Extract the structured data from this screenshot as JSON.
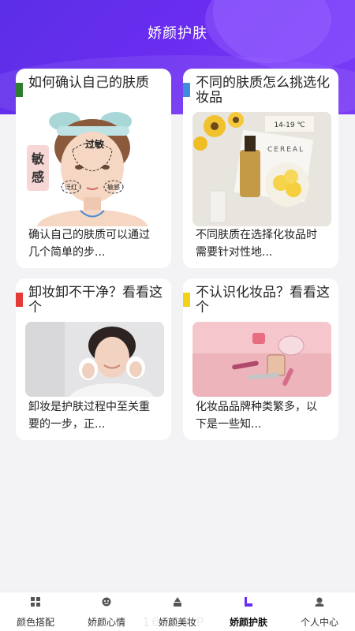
{
  "header": {
    "title": "娇颜护肤"
  },
  "cards": [
    {
      "title": "如何确认自己的肤质",
      "accent": "#2e7d32",
      "description": "确认自己的肤质可以通过几个简单的步...",
      "image_labels": {
        "big": "敏感",
        "top": "过敏",
        "left": "泛红",
        "right": "敏感"
      }
    },
    {
      "title": "不同的肤质怎么挑选化妆品",
      "accent": "#3f8be0",
      "description": "不同肤质在选择化妆品时需要针对性地...",
      "image_labels": {
        "tag": "14-19 ℃",
        "brand": "CEREAL"
      }
    },
    {
      "title": "卸妆卸不干净？看看这个",
      "accent": "#e53935",
      "description": "卸妆是护肤过程中至关重要的一步，正..."
    },
    {
      "title": "不认识化妆品？看看这个",
      "accent": "#f2d21b",
      "description": "化妆品品牌种类繁多，以下是一些知..."
    }
  ],
  "nav": [
    {
      "label": "颜色搭配",
      "icon": "grid-icon"
    },
    {
      "label": "娇颜心情",
      "icon": "smile-icon"
    },
    {
      "label": "娇颜美妆",
      "icon": "makeup-icon"
    },
    {
      "label": "娇颜护肤",
      "icon": "skincare-icon",
      "active": true
    },
    {
      "label": "个人中心",
      "icon": "user-icon"
    }
  ],
  "watermark": "168A9 P"
}
